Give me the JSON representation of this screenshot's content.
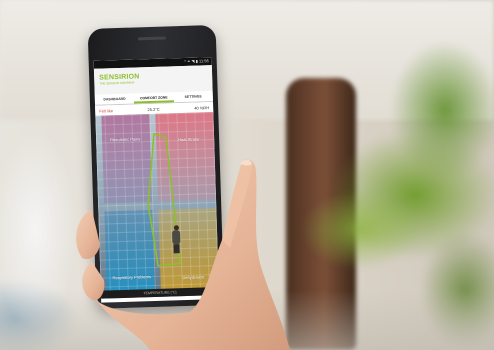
{
  "phone": {
    "status_bar": "* ⚭ ◥ ▮ 11:56",
    "app_logo": "SENSIRION",
    "app_logo_sub": "THE SENSOR COMPANY",
    "tabs": [
      {
        "label": "DASHBOARD",
        "active": false
      },
      {
        "label": "COMFORT ZONE",
        "active": true
      },
      {
        "label": "SETTINGS",
        "active": false
      }
    ],
    "readings": {
      "label": "Felt like",
      "temperature": "25.2°C",
      "humidity": "40 %RH"
    },
    "zones": {
      "top_left": "Rheumatic Pains",
      "top_right": "Heat Stroke",
      "bottom_left": "Respiratory Problems",
      "bottom_right": "Dehydration"
    },
    "x_axis_label": "TEMPERATURE [°C]"
  },
  "colors": {
    "brand": "#8dbf2c",
    "alert": "#d5453a",
    "comfort_outline": "#8dbf2c"
  }
}
